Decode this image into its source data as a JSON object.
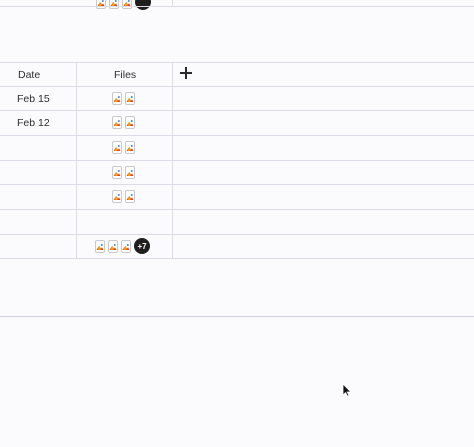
{
  "table": {
    "columns": {
      "date": "Date",
      "files": "Files"
    },
    "add_column_icon": "plus-icon",
    "top_partial_row": {
      "files_count_visible": 3,
      "more_badge": ""
    },
    "rows": [
      {
        "date": "Feb 15",
        "file_icons": 2,
        "more": ""
      },
      {
        "date": "Feb 12",
        "file_icons": 2,
        "more": ""
      },
      {
        "date": "",
        "file_icons": 2,
        "more": ""
      },
      {
        "date": "",
        "file_icons": 2,
        "more": ""
      },
      {
        "date": "",
        "file_icons": 2,
        "more": ""
      },
      {
        "date": "",
        "file_icons": 0,
        "more": ""
      },
      {
        "date": "",
        "file_icons": 3,
        "more": "+7"
      }
    ]
  },
  "file_icon": "file-thumbnail-icon",
  "cursor_icon": "mouse-pointer-icon",
  "colors": {
    "grid": "#dcdbe6",
    "badge": "#1e1e1e",
    "background": "#fbfafc"
  }
}
